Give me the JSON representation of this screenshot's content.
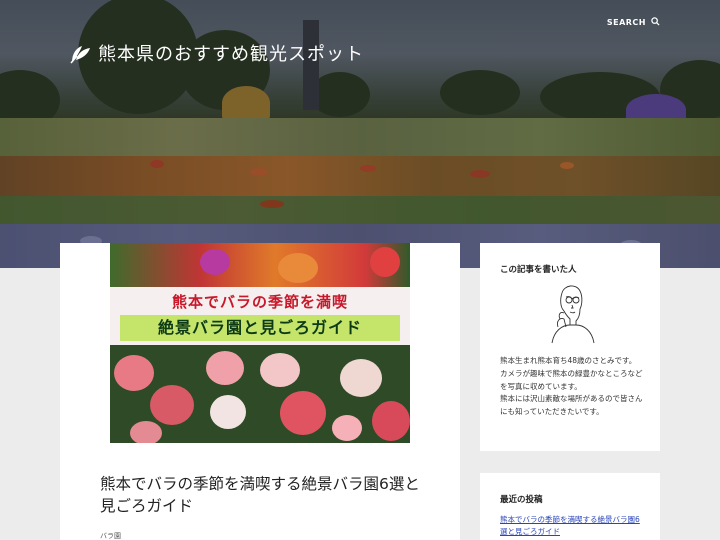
{
  "header": {
    "site_title": "熊本県のおすすめ観光スポット",
    "search_label": "SEARCH",
    "logo_icon": "leaf-icon",
    "search_icon": "search-icon"
  },
  "post": {
    "thumbnail": {
      "banner_line1": "熊本でバラの季節を満喫",
      "banner_line2": "絶景バラ園と見ごろガイド"
    },
    "title": "熊本でバラの季節を満喫する絶景バラ園6選と見ごろガイド",
    "category": "バラ園"
  },
  "sidebar": {
    "about": {
      "heading": "この記事を書いた人",
      "avatar_icon": "author-portrait",
      "bio_lines": [
        "熊本生まれ熊本育ち48歳のさとみです。",
        "カメラが趣味で熊本の緑豊かなところなどを写真に収めています。",
        "熊本には沢山素敵な場所があるので皆さんにも知っていただきたいです。"
      ]
    },
    "recent": {
      "heading": "最近の投稿",
      "items": [
        "熊本でバラの季節を満喫する絶景バラ園6選と見ごろガイド"
      ]
    }
  },
  "colors": {
    "banner_red": "#c8182a",
    "banner_green": "#c5e46a",
    "link_blue": "#2a45b8"
  }
}
